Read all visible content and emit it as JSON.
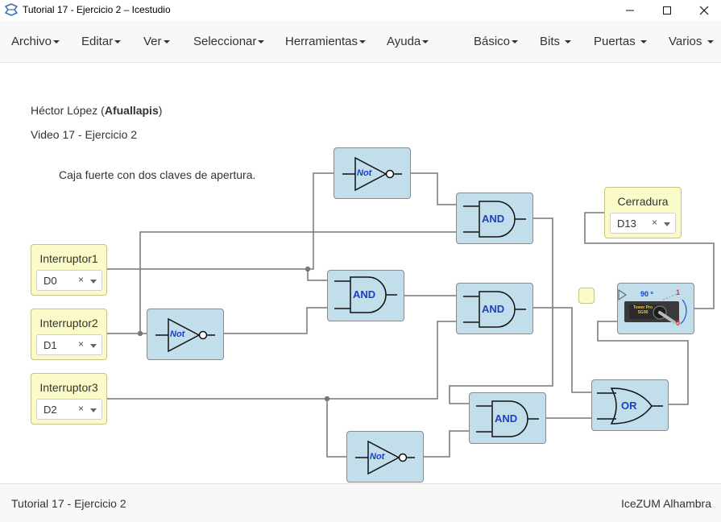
{
  "window": {
    "title": "Tutorial 17 - Ejercicio 2 – Icestudio"
  },
  "menu": {
    "left": [
      "Archivo",
      "Editar",
      "Ver",
      "Seleccionar",
      "Herramientas",
      "Ayuda"
    ],
    "right": [
      "Básico",
      "Bits",
      "Puertas",
      "Varios"
    ]
  },
  "notes": {
    "author_name": "Héctor López (",
    "author_nick": "Afuallapis",
    "author_close": ")",
    "video": "Video 17 - Ejercicio 2",
    "description": "Caja fuerte con dos claves de apertura."
  },
  "inputs": [
    {
      "name": "Interruptor1",
      "pin": "D0"
    },
    {
      "name": "Interruptor2",
      "pin": "D1"
    },
    {
      "name": "Interruptor3",
      "pin": "D2"
    }
  ],
  "output": {
    "name": "Cerradura",
    "pin": "D13"
  },
  "gates": {
    "not_label": "Not",
    "and_label": "AND",
    "or_label": "OR"
  },
  "servo": {
    "angle": "90 º",
    "high": "1",
    "low": "0",
    "chip_text": "Tower Pro SG90"
  },
  "status": {
    "left": "Tutorial 17 - Ejercicio 2",
    "right": "IceZUM Alhambra"
  },
  "colors": {
    "block": "#c1deea",
    "io": "#fbfbc9",
    "gate_text": "#1a3fc4",
    "wire": "#777777"
  }
}
